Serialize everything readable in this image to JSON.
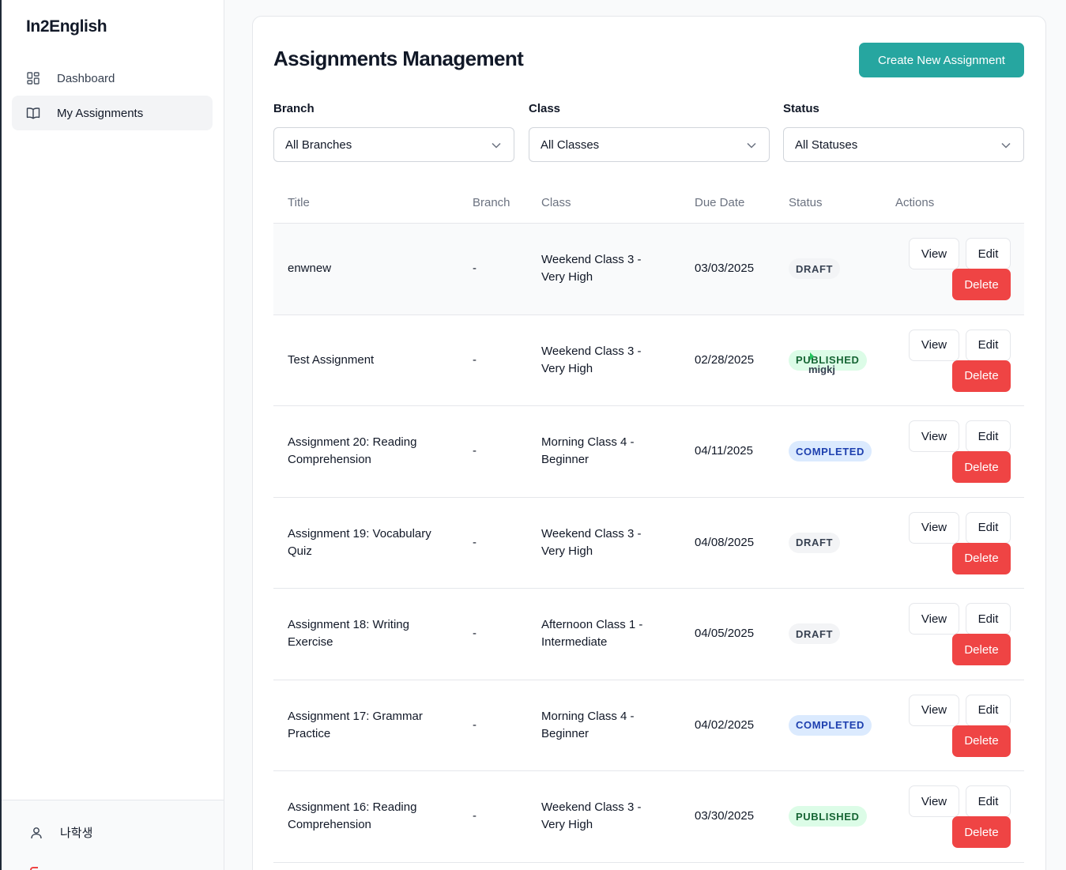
{
  "app": {
    "logo": "In2English"
  },
  "sidebar": {
    "items": [
      {
        "label": "Dashboard",
        "icon": "grid-icon"
      },
      {
        "label": "My Assignments",
        "icon": "book-icon",
        "active": true
      }
    ],
    "user": {
      "name": "나학생",
      "icon": "user-icon"
    }
  },
  "header": {
    "title": "Assignments Management",
    "create_label": "Create New Assignment"
  },
  "filters": {
    "branch": {
      "label": "Branch",
      "value": "All Branches"
    },
    "class": {
      "label": "Class",
      "value": "All Classes"
    },
    "status": {
      "label": "Status",
      "value": "All Statuses"
    }
  },
  "table": {
    "columns": {
      "title": "Title",
      "branch": "Branch",
      "class": "Class",
      "due": "Due Date",
      "status": "Status",
      "actions": "Actions"
    },
    "actions": {
      "view": "View",
      "edit": "Edit",
      "delete": "Delete"
    },
    "rows": [
      {
        "title": [
          "enwnew"
        ],
        "branch": "-",
        "class": [
          "Weekend Class 3 -",
          "Very High"
        ],
        "due": "03/03/2025",
        "status": "DRAFT",
        "status_kind": "draft"
      },
      {
        "title": [
          "Test Assignment"
        ],
        "branch": "-",
        "class": [
          "Weekend Class 3 -",
          "Very High"
        ],
        "due": "02/28/2025",
        "status": "PUBLISHED",
        "status_kind": "published",
        "overlay": "migkj"
      },
      {
        "title": [
          "Assignment 20: Reading",
          "Comprehension"
        ],
        "branch": "-",
        "class": [
          "Morning Class 4 -",
          "Beginner"
        ],
        "due": "04/11/2025",
        "status": "COMPLETED",
        "status_kind": "completed"
      },
      {
        "title": [
          "Assignment 19: Vocabulary",
          "Quiz"
        ],
        "branch": "-",
        "class": [
          "Weekend Class 3 -",
          "Very High"
        ],
        "due": "04/08/2025",
        "status": "DRAFT",
        "status_kind": "draft"
      },
      {
        "title": [
          "Assignment 18: Writing",
          "Exercise"
        ],
        "branch": "-",
        "class": [
          "Afternoon Class 1 -",
          "Intermediate"
        ],
        "due": "04/05/2025",
        "status": "DRAFT",
        "status_kind": "draft"
      },
      {
        "title": [
          "Assignment 17: Grammar",
          "Practice"
        ],
        "branch": "-",
        "class": [
          "Morning Class 4 -",
          "Beginner"
        ],
        "due": "04/02/2025",
        "status": "COMPLETED",
        "status_kind": "completed"
      },
      {
        "title": [
          "Assignment 16: Reading",
          "Comprehension"
        ],
        "branch": "-",
        "class": [
          "Weekend Class 3 -",
          "Very High"
        ],
        "due": "03/30/2025",
        "status": "PUBLISHED",
        "status_kind": "published"
      }
    ]
  },
  "colors": {
    "accent": "#26a6a0",
    "danger": "#ef4444",
    "draft_bg": "#f3f4f6",
    "published_bg": "#dcfce7",
    "completed_bg": "#dbeafe"
  }
}
